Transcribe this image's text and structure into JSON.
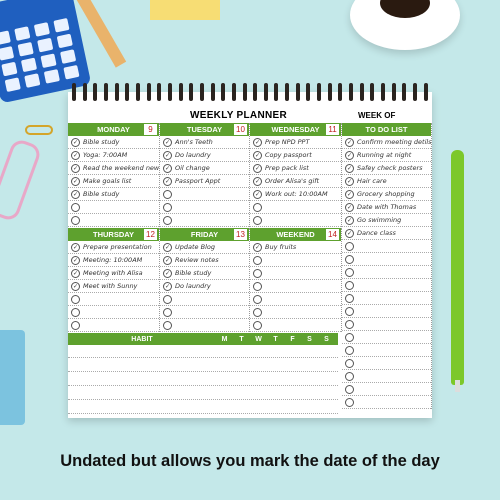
{
  "planner": {
    "title": "WEEKLY PLANNER",
    "week_of_label": "WEEK OF",
    "accent_color": "#5ea12e",
    "days_top": [
      {
        "name": "MONDAY",
        "date": "9",
        "tasks": [
          "Bible study",
          "Yoga: 7:00AM",
          "Read the weekend news",
          "Make goals list",
          "Bible study",
          "",
          ""
        ]
      },
      {
        "name": "TUESDAY",
        "date": "10",
        "tasks": [
          "Ann's Teeth",
          "Do laundry",
          "Oil change",
          "Passport Appt",
          "",
          "",
          ""
        ]
      },
      {
        "name": "WEDNESDAY",
        "date": "11",
        "tasks": [
          "Prep NPD PPT",
          "Copy passport",
          "Prep pack list",
          "Order Alisa's gift",
          "Work out: 10:00AM",
          "",
          ""
        ]
      }
    ],
    "days_bottom": [
      {
        "name": "THURSDAY",
        "date": "12",
        "tasks": [
          "Prepare presentation",
          "Meeting: 10:00AM",
          "Meeting with Alisa",
          "Meet with Sunny",
          "",
          "",
          ""
        ]
      },
      {
        "name": "FRIDAY",
        "date": "13",
        "tasks": [
          "Update Blog",
          "Review notes",
          "Bible study",
          "Do laundry",
          "",
          "",
          ""
        ]
      },
      {
        "name": "WEEKEND",
        "date": "14",
        "tasks": [
          "Buy fruits",
          "",
          "",
          "",
          "",
          "",
          ""
        ]
      }
    ],
    "todo": {
      "title": "TO DO LIST",
      "items": [
        "Confirm meeting detils",
        "Running at night",
        "Safey check posters",
        "Hair care",
        "Grocery shopping",
        "Date with Thomas",
        "Go swimming",
        "Dance class",
        "",
        "",
        "",
        "",
        "",
        "",
        "",
        "",
        "",
        "",
        "",
        "",
        ""
      ]
    },
    "habit": {
      "label": "HABIT",
      "days": [
        "M",
        "T",
        "W",
        "T",
        "F",
        "S",
        "S"
      ],
      "rows": 5
    }
  },
  "caption": "Undated but allows you mark the date of the day"
}
